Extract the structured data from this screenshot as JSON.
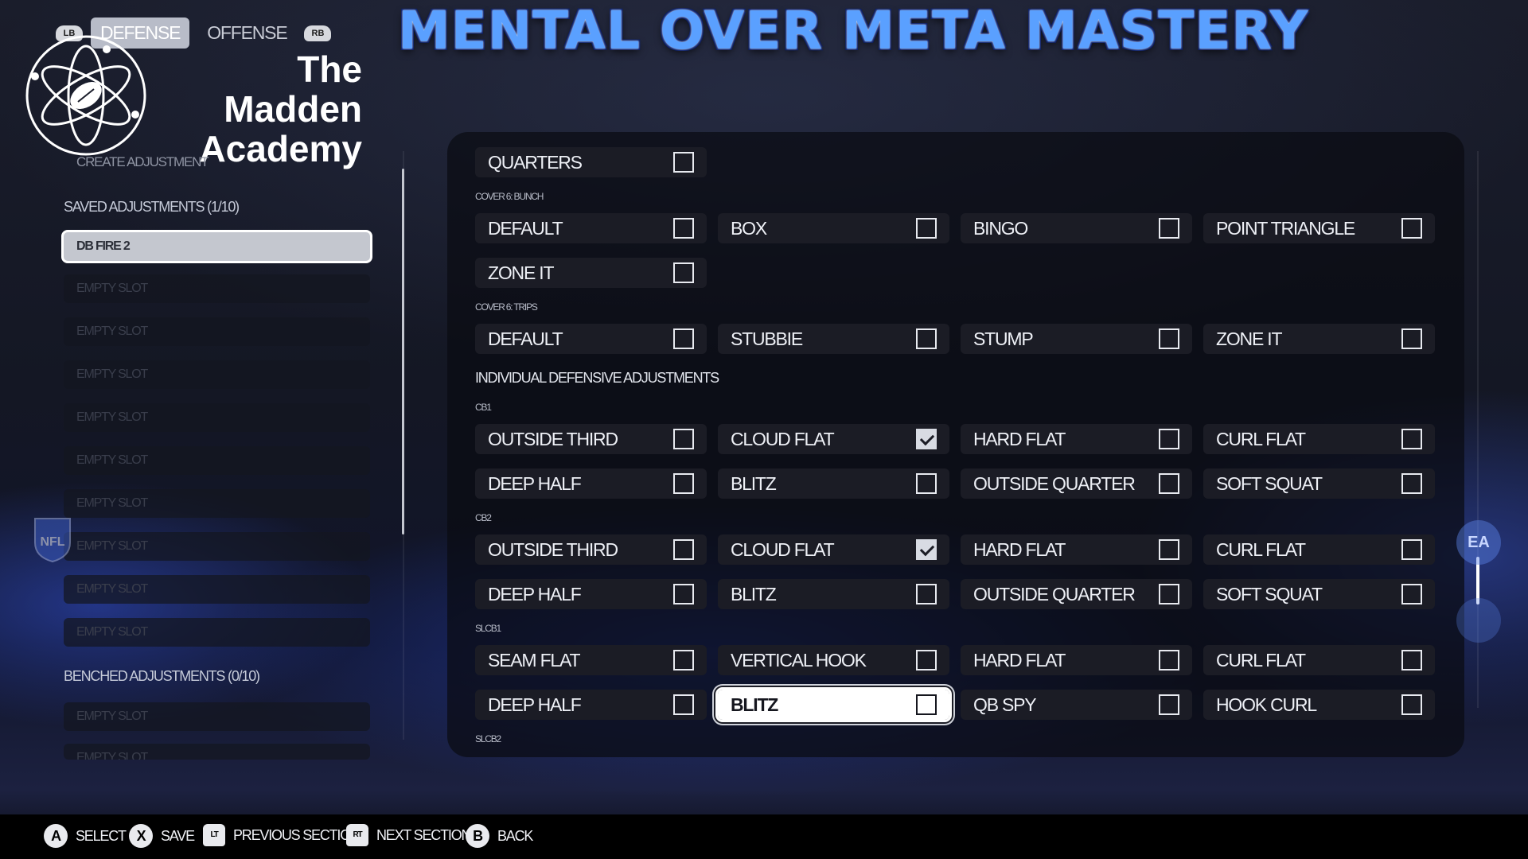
{
  "tabs": {
    "left_bumper": "LB",
    "defense": "DEFENSE",
    "offense": "OFFENSE",
    "right_bumper": "RB"
  },
  "brand": {
    "title_line1": "The Madden",
    "title_line2": "Academy",
    "overlay_title": "MENTAL OVER META MASTERY",
    "logo_icon": "atom-football-icon"
  },
  "sidebar": {
    "create_adjustment": "CREATE ADJUSTMENT",
    "saved_header": "SAVED ADJUSTMENTS (1/10)",
    "saved_slots": [
      "DB FIRE 2",
      "EMPTY SLOT",
      "EMPTY SLOT",
      "EMPTY SLOT",
      "EMPTY SLOT",
      "EMPTY SLOT",
      "EMPTY SLOT",
      "EMPTY SLOT",
      "EMPTY SLOT",
      "EMPTY SLOT"
    ],
    "benched_header": "BENCHED ADJUSTMENTS (0/10)",
    "benched_slots": [
      "EMPTY SLOT",
      "EMPTY SLOT"
    ]
  },
  "main": {
    "quarters_row": [
      {
        "label": "QUARTERS",
        "checked": false
      }
    ],
    "cover6_bunch_label": "COVER 6: BUNCH",
    "cover6_bunch": [
      [
        {
          "label": "DEFAULT",
          "checked": false
        },
        {
          "label": "BOX",
          "checked": false
        },
        {
          "label": "BINGO",
          "checked": false
        },
        {
          "label": "POINT TRIANGLE",
          "checked": false
        }
      ],
      [
        {
          "label": "ZONE IT",
          "checked": false
        }
      ]
    ],
    "cover6_trips_label": "COVER 6: TRIPS",
    "cover6_trips": [
      [
        {
          "label": "DEFAULT",
          "checked": false
        },
        {
          "label": "STUBBIE",
          "checked": false
        },
        {
          "label": "STUMP",
          "checked": false
        },
        {
          "label": "ZONE IT",
          "checked": false
        }
      ]
    ],
    "individual_header": "INDIVIDUAL DEFENSIVE ADJUSTMENTS",
    "cb1_label": "CB1",
    "cb1": [
      [
        {
          "label": "OUTSIDE THIRD",
          "checked": false
        },
        {
          "label": "CLOUD FLAT",
          "checked": true
        },
        {
          "label": "HARD FLAT",
          "checked": false
        },
        {
          "label": "CURL FLAT",
          "checked": false
        }
      ],
      [
        {
          "label": "DEEP HALF",
          "checked": false
        },
        {
          "label": "BLITZ",
          "checked": false
        },
        {
          "label": "OUTSIDE QUARTER",
          "checked": false
        },
        {
          "label": "SOFT SQUAT",
          "checked": false
        }
      ]
    ],
    "cb2_label": "CB2",
    "cb2": [
      [
        {
          "label": "OUTSIDE THIRD",
          "checked": false
        },
        {
          "label": "CLOUD FLAT",
          "checked": true
        },
        {
          "label": "HARD FLAT",
          "checked": false
        },
        {
          "label": "CURL FLAT",
          "checked": false
        }
      ],
      [
        {
          "label": "DEEP HALF",
          "checked": false
        },
        {
          "label": "BLITZ",
          "checked": false
        },
        {
          "label": "OUTSIDE QUARTER",
          "checked": false
        },
        {
          "label": "SOFT SQUAT",
          "checked": false
        }
      ]
    ],
    "slcb1_label": "SLCB1",
    "slcb1": [
      [
        {
          "label": "SEAM FLAT",
          "checked": false
        },
        {
          "label": "VERTICAL HOOK",
          "checked": false
        },
        {
          "label": "HARD FLAT",
          "checked": false
        },
        {
          "label": "CURL FLAT",
          "checked": false
        }
      ],
      [
        {
          "label": "DEEP HALF",
          "checked": false
        },
        {
          "label": "BLITZ",
          "checked": false,
          "focused": true
        },
        {
          "label": "QB SPY",
          "checked": false
        },
        {
          "label": "HOOK CURL",
          "checked": false
        }
      ]
    ],
    "slcb2_label": "SLCB2"
  },
  "side_logos": {
    "ea": "EA"
  },
  "footer": {
    "hints": [
      {
        "button": "A",
        "label": "SELECT"
      },
      {
        "button": "X",
        "label": "SAVE"
      },
      {
        "button": "LT",
        "label": "PREVIOUS SECTION"
      },
      {
        "button": "RT",
        "label": "NEXT SECTION"
      },
      {
        "button": "B",
        "label": "BACK"
      }
    ]
  },
  "colors": {
    "accent_blue": "#5aa0ff",
    "panel_bg": "#0a0b12",
    "option_bg": "#1b1c25"
  }
}
